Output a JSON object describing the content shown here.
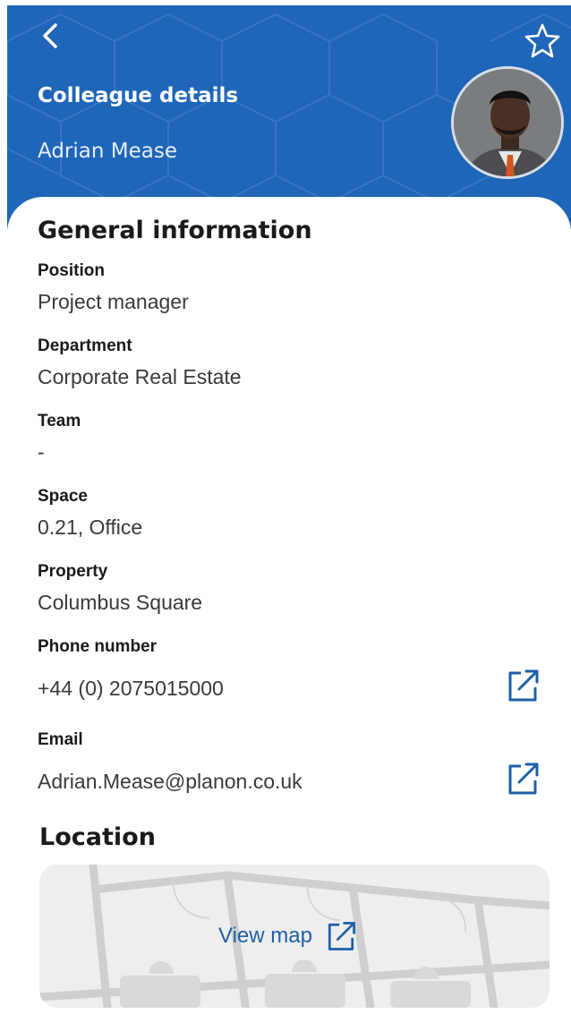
{
  "header": {
    "title": "Colleague details",
    "name": "Adrian Mease",
    "back_icon": "chevron-left-icon",
    "favorite_icon": "star-outline-icon",
    "background_color": "#1f66b8"
  },
  "general": {
    "title": "General information",
    "fields": [
      {
        "label": "Position",
        "value": "Project manager"
      },
      {
        "label": "Department",
        "value": "Corporate Real Estate"
      },
      {
        "label": "Team",
        "value": "-"
      },
      {
        "label": "Space",
        "value": "0.21, Office"
      },
      {
        "label": "Property",
        "value": "Columbus Square"
      },
      {
        "label": "Phone number",
        "value": "+44 (0) 2075015000"
      },
      {
        "label": "Email",
        "value": "Adrian.Mease@planon.co.uk"
      }
    ],
    "link_icon": "external-link-icon"
  },
  "location": {
    "title": "Location",
    "map_link_label": "View map"
  },
  "colors": {
    "accent": "#1f5fa8",
    "text": "#1a1a1a"
  }
}
